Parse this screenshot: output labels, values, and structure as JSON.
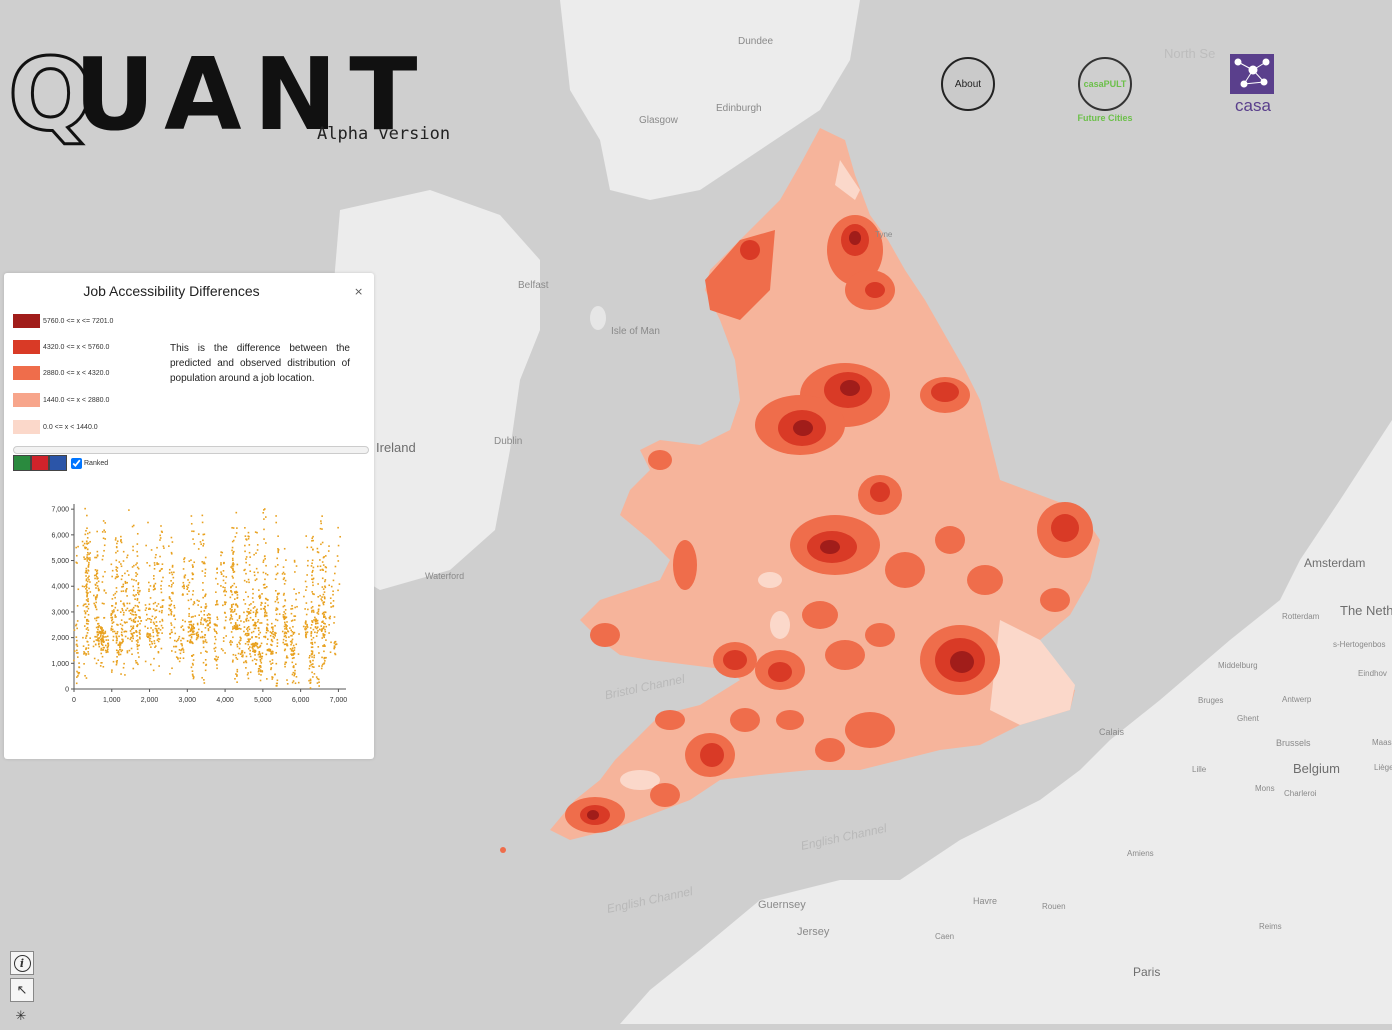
{
  "app": {
    "title_first": "Q",
    "title_rest": "UANT",
    "subtitle": "Alpha version"
  },
  "header": {
    "about_label": "About",
    "casapult_label": "casaPULT",
    "future_cities_label": "Future Cities",
    "casa_label": "casa"
  },
  "panel": {
    "title": "Job Accessibility Differences",
    "close": "×",
    "description": "This is the difference between the predicted and observed distribution of population around a job location.",
    "legend": [
      {
        "label": "5760.0 <= x <= 7201.0",
        "color": "#a11d1a"
      },
      {
        "label": "4320.0 <= x < 5760.0",
        "color": "#d93a26"
      },
      {
        "label": "2880.0 <= x < 4320.0",
        "color": "#ef6d4b"
      },
      {
        "label": "1440.0 <= x < 2880.0",
        "color": "#f7a58b"
      },
      {
        "label": "0.0 <= x < 1440.0",
        "color": "#fbd8ca"
      }
    ],
    "color_buttons": [
      "#2a8a3e",
      "#d0232b",
      "#2b55a8"
    ],
    "ranked_label": "Ranked",
    "ranked_checked": true
  },
  "chart_data": {
    "type": "scatter",
    "title": "",
    "xlabel": "",
    "ylabel": "",
    "xlim": [
      0,
      7201
    ],
    "ylim": [
      0,
      7201
    ],
    "x_ticks": [
      "0",
      "1,000",
      "2,000",
      "3,000",
      "4,000",
      "5,000",
      "6,000",
      "7,000"
    ],
    "y_ticks": [
      "0",
      "1,000",
      "2,000",
      "3,000",
      "4,000",
      "5,000",
      "6,000",
      "7,000"
    ],
    "point_color": "#e8a11f",
    "grid": false,
    "series": [
      {
        "values": "dense scatter of several thousand points spanning x 0–7,000 and y 0–7,000"
      }
    ]
  },
  "map": {
    "labels": {
      "dundee": "Dundee",
      "north_sea": "North Se",
      "glasgow": "Glasgow",
      "edinburgh": "Edinburgh",
      "tyne": "Tyne",
      "belfast": "Belfast",
      "isle_of_man": "Isle of Man",
      "ireland": "Ireland",
      "dublin": "Dublin",
      "waterford": "Waterford",
      "bristol_channel": "Bristol Channel",
      "english_channel": "English Channel",
      "english_channel2": "English Channel",
      "guernsey": "Guernsey",
      "jersey": "Jersey",
      "calais": "Calais",
      "amsterdam": "Amsterdam",
      "the_neth": "The Neth",
      "rotterdam": "Rotterdam",
      "s_hertogenbosch": "s-Hertogenbos",
      "middelburg": "Middelburg",
      "eindhoven": "Eindhov",
      "bruges": "Bruges",
      "antwerp": "Antwerp",
      "ghent": "Ghent",
      "brussels": "Brussels",
      "maas": "Maas",
      "belgium": "Belgium",
      "liege": "Liège",
      "lille": "Lille",
      "mons": "Mons",
      "charleroi": "Charleroi",
      "havre": "Havre",
      "rouen": "Rouen",
      "caen": "Caen",
      "amiens": "Amiens",
      "reims": "Reims",
      "paris": "Paris"
    }
  },
  "tools": {
    "info_icon": "i",
    "pointer_icon": "↖",
    "pan_icon": "✳"
  }
}
